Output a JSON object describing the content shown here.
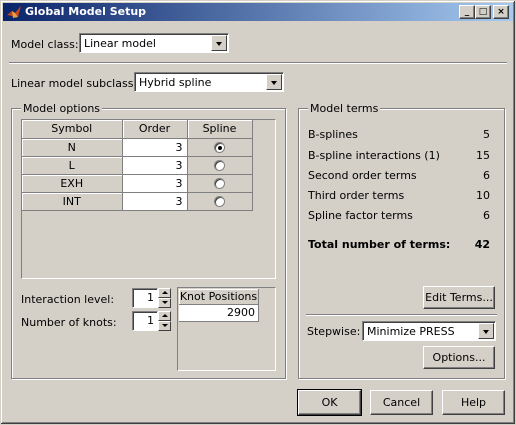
{
  "window": {
    "title": "Global Model Setup",
    "buttons": {
      "minimize": "_",
      "maximize": "□",
      "close": "×"
    }
  },
  "model_class": {
    "label": "Model class:",
    "value": "Linear model"
  },
  "subclass": {
    "label": "Linear model subclass:",
    "value": "Hybrid spline"
  },
  "model_options": {
    "title": "Model options",
    "columns": [
      "Symbol",
      "Order",
      "Spline"
    ],
    "rows": [
      {
        "symbol": "N",
        "order": "3",
        "spline": true
      },
      {
        "symbol": "L",
        "order": "3",
        "spline": false
      },
      {
        "symbol": "EXH",
        "order": "3",
        "spline": false
      },
      {
        "symbol": "INT",
        "order": "3",
        "spline": false
      }
    ],
    "interaction_level": {
      "label": "Interaction level:",
      "value": "1"
    },
    "number_of_knots": {
      "label": "Number of knots:",
      "value": "1"
    },
    "knot_positions": {
      "header": "Knot Positions",
      "values": [
        "2900"
      ]
    }
  },
  "model_terms": {
    "title": "Model terms",
    "terms": [
      {
        "label": "B-splines",
        "value": "5"
      },
      {
        "label": "B-spline interactions (1)",
        "value": "15"
      },
      {
        "label": "Second order terms",
        "value": "6"
      },
      {
        "label": "Third order terms",
        "value": "10"
      },
      {
        "label": "Spline factor terms",
        "value": "6"
      }
    ],
    "total": {
      "label": "Total number of terms:",
      "value": "42"
    },
    "edit_terms_button": "Edit Terms...",
    "stepwise": {
      "label": "Stepwise:",
      "value": "Minimize PRESS"
    },
    "options_button": "Options..."
  },
  "footer": {
    "ok": "OK",
    "cancel": "Cancel",
    "help": "Help"
  }
}
